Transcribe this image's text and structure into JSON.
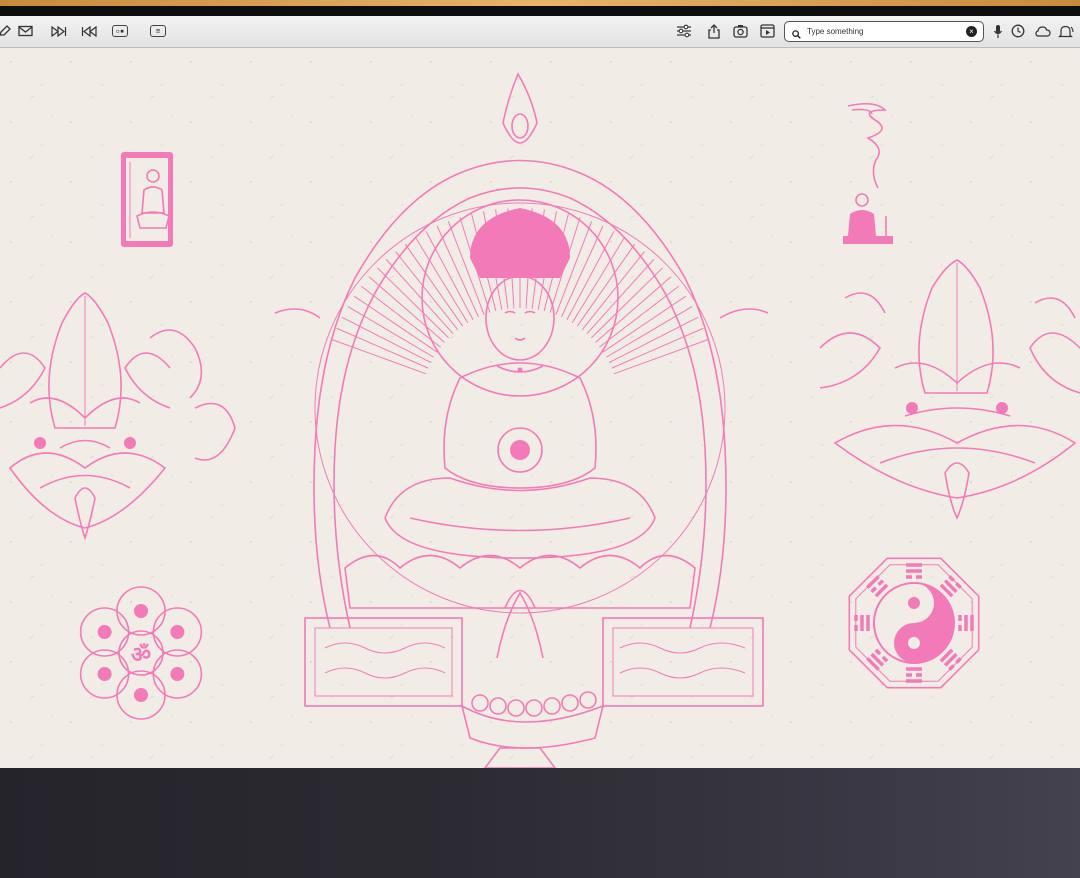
{
  "toolbar": {
    "left_icons": [
      "edit-icon",
      "mail-icon",
      "fast-forward-icon",
      "rewind-icon",
      "picture-in-picture-icon",
      "subtitles-icon"
    ],
    "right_icons": [
      "sliders-icon",
      "share-icon",
      "camera-icon",
      "media-icon"
    ],
    "search": {
      "placeholder": "Type something",
      "value": ""
    },
    "tray_icons": [
      "microphone-icon",
      "clock-icon",
      "cloud-icon",
      "notifications-icon"
    ]
  },
  "artwork": {
    "ink_color": "#f37ab8",
    "paper_color": "#f1ede6",
    "elements": [
      "seated-buddha-stamp",
      "incense-buddha-stamp",
      "praying-hands-lotus-left",
      "central-buddha-throne",
      "praying-hands-lotus-right",
      "mantra-lotus-seal",
      "bagua-yin-yang-seal"
    ]
  }
}
